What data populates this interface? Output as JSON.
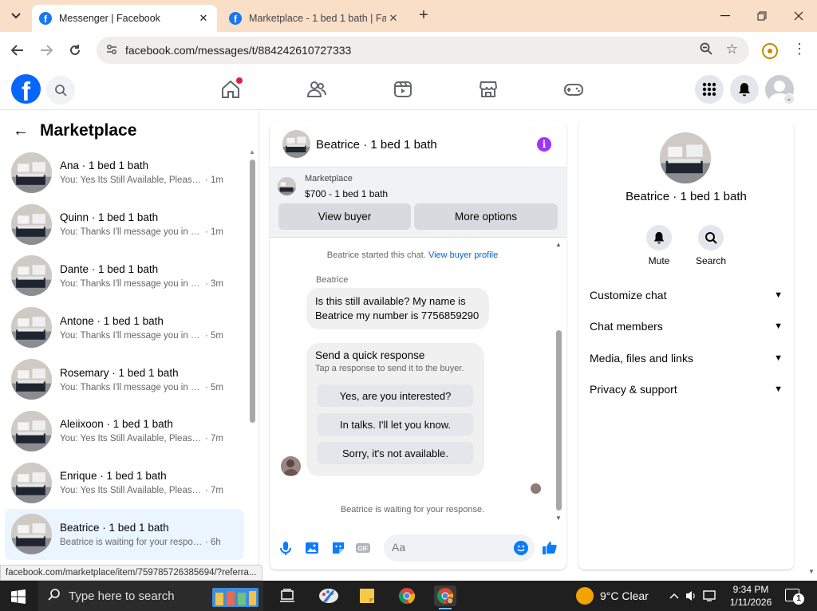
{
  "browser": {
    "tabs": [
      {
        "title": "Messenger | Facebook",
        "active": true
      },
      {
        "title": "Marketplace - 1 bed 1 bath | Fa",
        "active": false
      }
    ],
    "url": "facebook.com/messages/t/884242610727333",
    "status_url": "facebook.com/marketplace/item/759785726385694/?referra..."
  },
  "fb": {
    "accent": "#0866ff",
    "nav_icons": [
      "home-icon",
      "friends-icon",
      "watch-icon",
      "marketplace-icon",
      "gaming-icon"
    ],
    "right_icons": [
      "menu-grid-icon",
      "notifications-bell-icon",
      "account-avatar"
    ]
  },
  "left_panel": {
    "back_icon": "arrow-left-icon",
    "title": "Marketplace",
    "conversations": [
      {
        "title": "Ana · 1 bed 1 bath",
        "preview": "You: Yes Its Still Available, Please S...",
        "time": "· 1m",
        "selected": false
      },
      {
        "title": "Quinn · 1 bed 1 bath",
        "preview": "You: Thanks I'll message you in a ...",
        "time": "· 1m",
        "selected": false
      },
      {
        "title": "Dante · 1 bed 1 bath",
        "preview": "You: Thanks I'll message you in a ...",
        "time": "· 3m",
        "selected": false
      },
      {
        "title": "Antone · 1 bed 1 bath",
        "preview": "You: Thanks I'll message you in a ...",
        "time": "· 5m",
        "selected": false
      },
      {
        "title": "Rosemary · 1 bed 1 bath",
        "preview": "You: Thanks I'll message you in a ...",
        "time": "· 5m",
        "selected": false
      },
      {
        "title": "Aleiixoon · 1 bed 1 bath",
        "preview": "You: Yes Its Still Available, Please S...",
        "time": "· 7m",
        "selected": false
      },
      {
        "title": "Enrique · 1 bed 1 bath",
        "preview": "You: Yes Its Still Available, Please S...",
        "time": "· 7m",
        "selected": false
      },
      {
        "title": "Beatrice · 1 bed 1 bath",
        "preview": "Beatrice is waiting for your respon...",
        "time": "· 6h",
        "selected": true
      }
    ]
  },
  "chat": {
    "title": "Beatrice · 1 bed 1 bath",
    "info_icon": "info-icon",
    "listing": {
      "label": "Marketplace",
      "price": "$700 - 1 bed 1 bath"
    },
    "buttons": {
      "view_buyer": "View buyer",
      "more_options": "More options"
    },
    "started_text": "Beatrice started this chat.",
    "view_profile_link": "View buyer profile",
    "sender": "Beatrice",
    "message": "Is this still available? My name is Beatrice my number is 7756859290",
    "quick": {
      "title": "Send a quick response",
      "subtitle": "Tap a response to send it to the buyer.",
      "options": [
        "Yes, are you interested?",
        "In talks. I'll let you know.",
        "Sorry, it's not available."
      ]
    },
    "waiting": "Beatrice is waiting for your response.",
    "composer": {
      "placeholder": "Aa",
      "icons": [
        "microphone-icon",
        "photo-icon",
        "sticker-icon",
        "gif-icon",
        "emoji-icon",
        "like-thumb-icon"
      ]
    }
  },
  "right_panel": {
    "name": "Beatrice · 1 bed 1 bath",
    "actions": [
      {
        "label": "Mute",
        "icon": "bell-icon"
      },
      {
        "label": "Search",
        "icon": "search-icon"
      }
    ],
    "sections": [
      "Customize chat",
      "Chat members",
      "Media, files and links",
      "Privacy & support"
    ]
  },
  "taskbar": {
    "search_placeholder": "Type here to search",
    "weather": "9°C  Clear",
    "time": "9:34 PM",
    "date": "1/11/2026",
    "notification_count": "1"
  }
}
